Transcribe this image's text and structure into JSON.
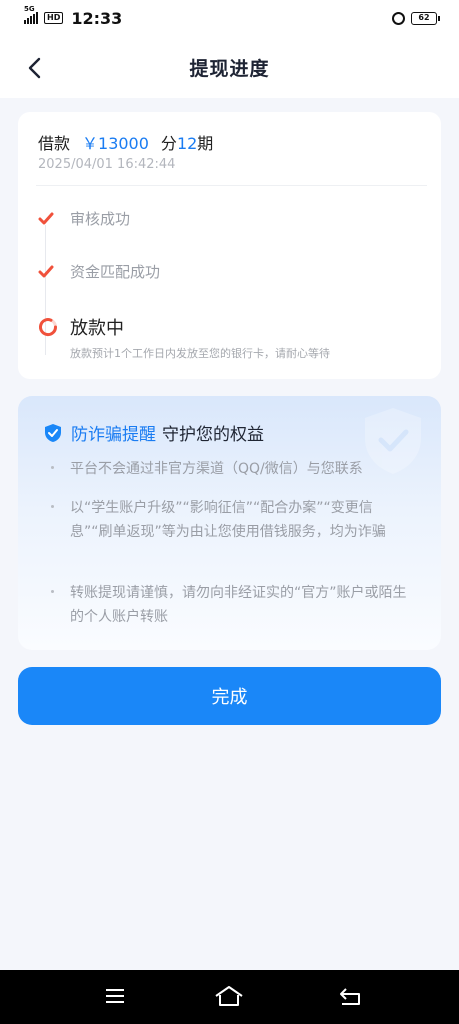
{
  "status_bar": {
    "network": "5G",
    "hd": "HD",
    "time": "12:33",
    "battery": "62"
  },
  "header": {
    "title": "提现进度"
  },
  "loan": {
    "label": "借款",
    "amount": "￥13000",
    "period_prefix": "分",
    "period_count": "12",
    "period_suffix": "期",
    "datetime": "2025/04/01 16:42:44"
  },
  "progress": {
    "steps": [
      {
        "label": "审核成功",
        "status": "done"
      },
      {
        "label": "资金匹配成功",
        "status": "done"
      },
      {
        "label": "放款中",
        "status": "in-progress"
      }
    ],
    "note": "放款预计1个工作日内发放至您的银行卡，请耐心等待"
  },
  "fraud_notice": {
    "title_highlight": "防诈骗提醒",
    "title_rest": "守护您的权益",
    "tips": [
      "平台不会通过非官方渠道（QQ/微信）与您联系",
      "以“学生账户升级”“影响征信”“配合办案”“变更信息”“刷单返现”等为由让您使用借钱服务，均为诈骗",
      "转账提现请谨慎，请勿向非经证实的“官方”账户或陌生的个人账户转账"
    ]
  },
  "actions": {
    "done_label": "完成"
  },
  "icons": {
    "back": "chevron-left-icon",
    "check": "check-icon",
    "loading": "loading-ring-icon",
    "shield": "shield-check-icon",
    "menu": "menu-icon",
    "home": "home-icon",
    "return": "back-arrow-icon"
  },
  "colors": {
    "accent": "#1a87f8",
    "check": "#f0513b",
    "text_secondary": "#9a9ea6"
  }
}
